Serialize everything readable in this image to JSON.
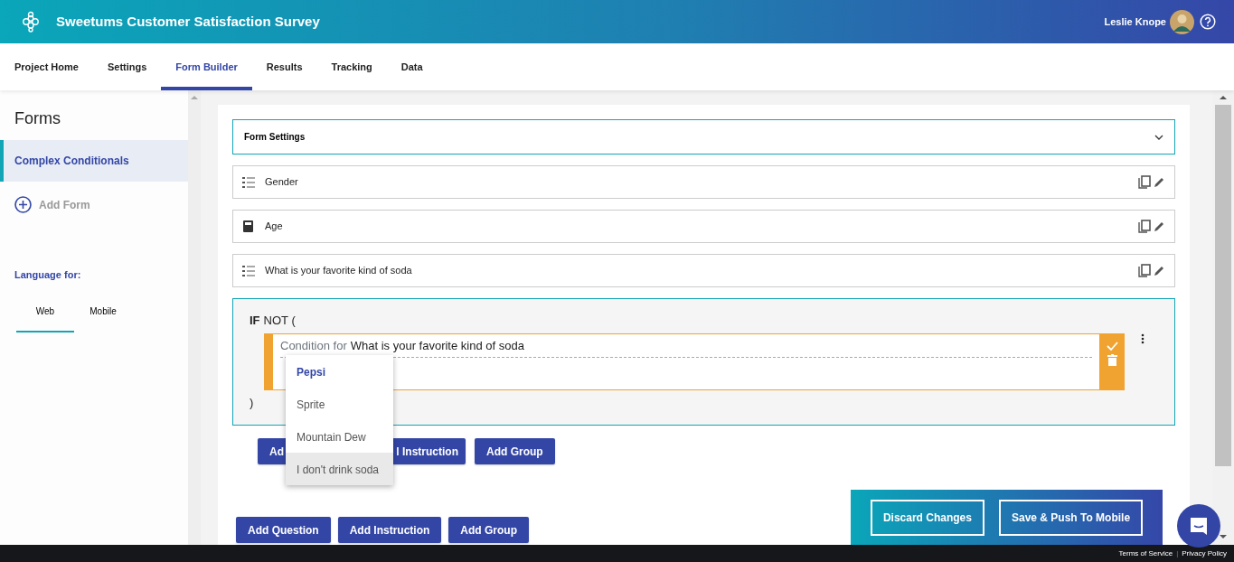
{
  "header": {
    "title": "Sweetums Customer Satisfaction Survey",
    "user": "Leslie Knope"
  },
  "tabs": [
    {
      "label": "Project Home",
      "selected": false
    },
    {
      "label": "Settings",
      "selected": false
    },
    {
      "label": "Form Builder",
      "selected": true
    },
    {
      "label": "Results",
      "selected": false
    },
    {
      "label": "Tracking",
      "selected": false
    },
    {
      "label": "Data",
      "selected": false
    }
  ],
  "sidebar": {
    "title": "Forms",
    "forms": [
      {
        "label": "Complex Conditionals",
        "selected": true
      }
    ],
    "add_form": "Add Form",
    "language_label": "Language for:",
    "language_tabs": [
      {
        "label": "Web",
        "selected": true
      },
      {
        "label": "Mobile",
        "selected": false
      }
    ]
  },
  "form": {
    "settings": "Form Settings",
    "questions": [
      {
        "label": "Gender",
        "kind": "choice"
      },
      {
        "label": "Age",
        "kind": "number"
      },
      {
        "label": "What is your favorite kind of soda",
        "kind": "choice"
      }
    ],
    "condition": {
      "keyword": "IF",
      "operator": "NOT (",
      "prefix": "Condition for",
      "question": "What is your favorite kind of soda",
      "close": ")",
      "options": [
        {
          "label": "Pepsi",
          "selected": true,
          "hovered": false
        },
        {
          "label": "Sprite",
          "selected": false,
          "hovered": false
        },
        {
          "label": "Mountain Dew",
          "selected": false,
          "hovered": false
        },
        {
          "label": "I don't drink soda",
          "selected": false,
          "hovered": true
        }
      ],
      "buttons": [
        "Ad",
        "l Instruction",
        "Add Group"
      ]
    },
    "buttons": [
      "Add Question",
      "Add Instruction",
      "Add Group"
    ]
  },
  "actions": [
    "Discard Changes",
    "Save & Push To Mobile"
  ],
  "footer": {
    "links": [
      "Terms of Service",
      "Privacy Policy"
    ],
    "separator": "|"
  }
}
